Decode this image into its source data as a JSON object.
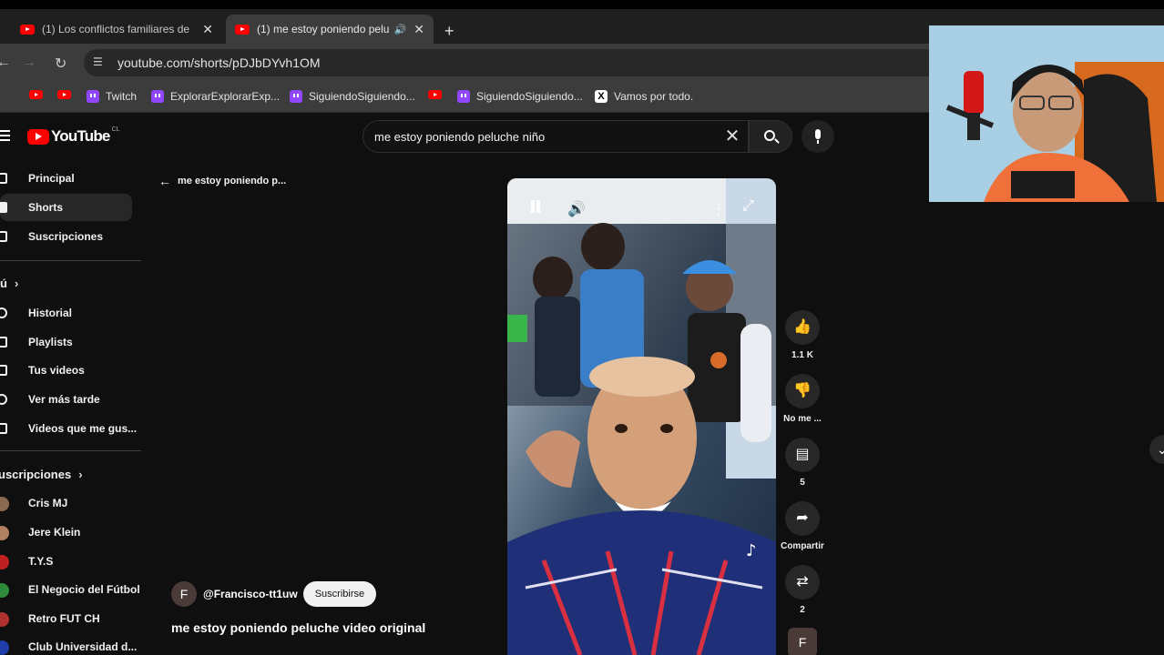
{
  "browser": {
    "tabs": [
      {
        "label": "(1) Los conflictos familiares de",
        "close": "✕"
      },
      {
        "label": "(1) me estoy poniendo pelu",
        "close": "✕"
      }
    ],
    "new_tab": "+",
    "url": "youtube.com/shorts/pDJbDYvh1OM",
    "bookmarks": [
      {
        "label": "",
        "icon": "youtube-icon"
      },
      {
        "label": "",
        "icon": "youtube-icon"
      },
      {
        "label": "Twitch",
        "icon": "twitch-icon"
      },
      {
        "label": "ExplorarExplorarExp...",
        "icon": "twitch-icon"
      },
      {
        "label": "SiguiendoSiguiendo...",
        "icon": "twitch-icon"
      },
      {
        "label": "",
        "icon": "youtube-icon"
      },
      {
        "label": "SiguiendoSiguiendo...",
        "icon": "twitch-icon"
      },
      {
        "label": "Vamos por todo.",
        "icon": "x-icon"
      }
    ]
  },
  "header": {
    "logo_text": "YouTube",
    "country": "CL",
    "search_value": "me estoy poniendo peluche niño"
  },
  "sidebar": {
    "main": [
      {
        "label": "Principal",
        "icon": "home-icon"
      },
      {
        "label": "Shorts",
        "icon": "shorts-icon"
      },
      {
        "label": "Suscripciones",
        "icon": "subscriptions-icon"
      }
    ],
    "you_heading": "ú",
    "you": [
      {
        "label": "Historial",
        "icon": "history-icon"
      },
      {
        "label": "Playlists",
        "icon": "playlists-icon"
      },
      {
        "label": "Tus videos",
        "icon": "your-videos-icon"
      },
      {
        "label": "Ver más tarde",
        "icon": "watch-later-icon"
      },
      {
        "label": "Videos que me gus...",
        "icon": "liked-icon"
      }
    ],
    "subs_heading": "uscripciones",
    "subs": [
      {
        "label": "Cris MJ",
        "color": "#8a6a50"
      },
      {
        "label": "Jere Klein",
        "color": "#b08060"
      },
      {
        "label": "T.Y.S",
        "color": "#c02020"
      },
      {
        "label": "El Negocio del Fútbol",
        "color": "#2e8b3a"
      },
      {
        "label": "Retro FUT CH",
        "color": "#b03030"
      },
      {
        "label": "Club Universidad d...",
        "color": "#1f3fa8"
      }
    ]
  },
  "shorts": {
    "back_title": "me estoy poniendo p...",
    "channel_initial": "F",
    "channel": "@Francisco-tt1uw",
    "subscribe": "Suscribirse",
    "title": "me estoy poniendo peluche video original"
  },
  "actions": {
    "likes": "1.1 K",
    "dislike": "No me ...",
    "comments": "5",
    "share": "Compartir",
    "remix": "2",
    "channel_initial": "F"
  },
  "colors": {
    "accent": "#ff0000",
    "twitch": "#9146ff",
    "background": "#0f0f0f"
  }
}
